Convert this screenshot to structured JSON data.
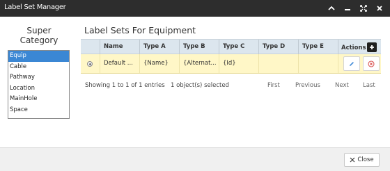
{
  "window": {
    "title": "Label Set Manager",
    "icons": [
      "chevron-up-icon",
      "minimize-icon",
      "maximize-icon",
      "close-icon"
    ]
  },
  "left_panel": {
    "title_line1": "Super",
    "title_line2": "Category",
    "items": [
      "Equip",
      "Cable",
      "Pathway",
      "Location",
      "MainHole",
      "Space"
    ],
    "selected": "Equip",
    "selected_color": "#3b87d4"
  },
  "main": {
    "title": "Label Sets For Equipment",
    "columns": [
      "Name",
      "Type A",
      "Type B",
      "Type C",
      "Type D",
      "Type E",
      "Actions"
    ],
    "sort_column": "Name",
    "rows": [
      {
        "name": "Default ...",
        "type_a": "{Name}",
        "type_b": "{Alternat...",
        "type_c": "{Id}",
        "type_d": "",
        "type_e": ""
      }
    ],
    "row_highlight_color": "#fff7c7",
    "header_color": "#dce6ee"
  },
  "footer": {
    "info": "Showing 1 to 1 of 1 entries",
    "selected": "1 object(s) selected",
    "pager": [
      "First",
      "Previous",
      "Next",
      "Last"
    ]
  },
  "bottom": {
    "close_label": "Close"
  }
}
